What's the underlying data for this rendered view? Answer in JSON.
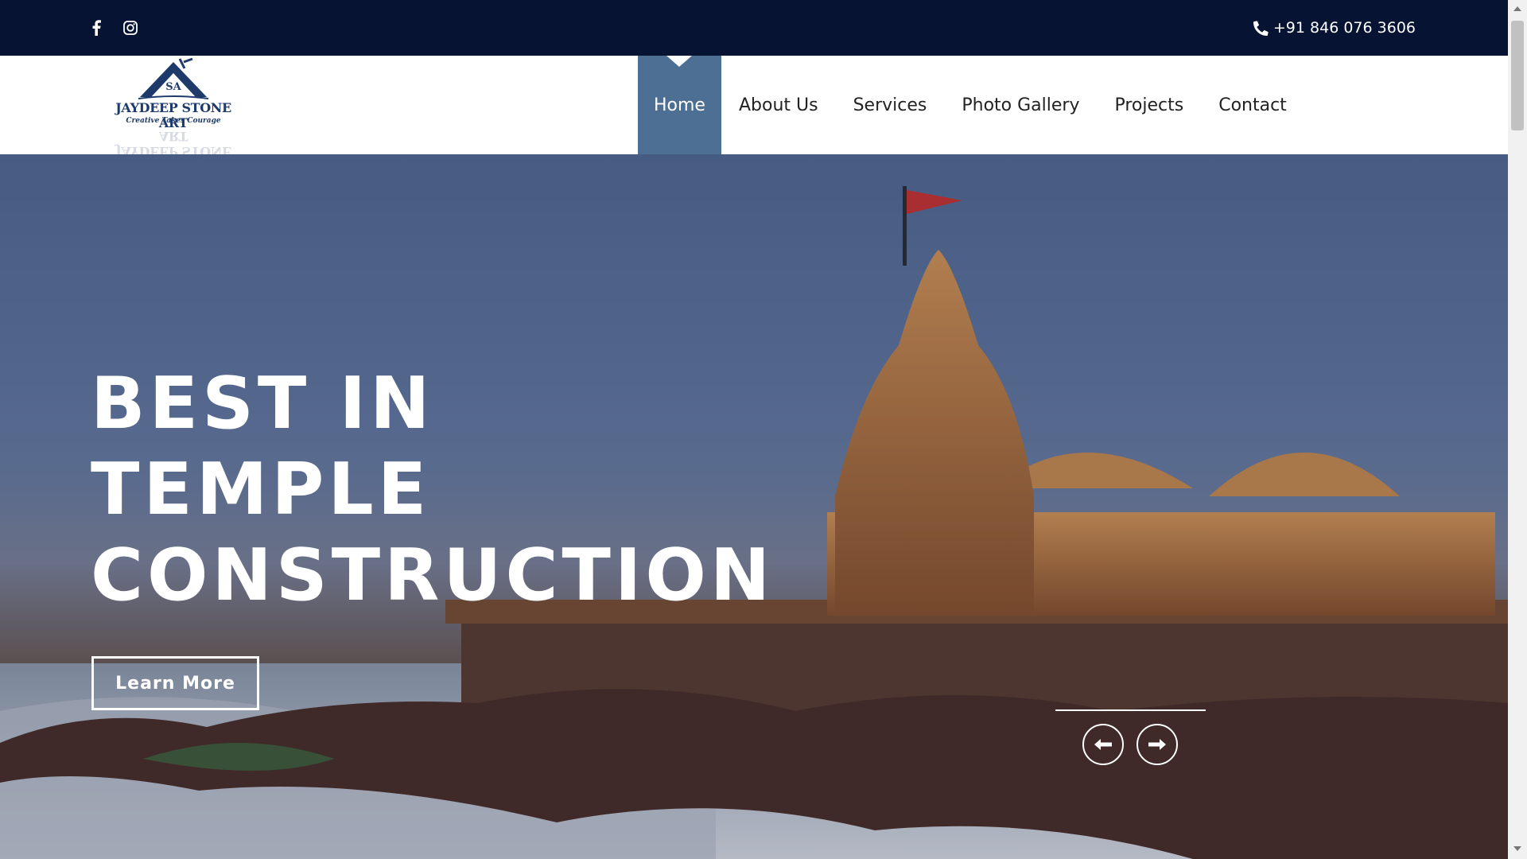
{
  "topbar": {
    "social": [
      {
        "name": "facebook",
        "icon": "facebook-icon"
      },
      {
        "name": "instagram",
        "icon": "instagram-icon"
      }
    ],
    "phone_icon": "phone-icon",
    "phone": "+91 846 076 3606"
  },
  "logo": {
    "wordmark": "JAYDEEP STONE ART",
    "tagline": "Creative Takes Courage",
    "monogram": "SA"
  },
  "nav": {
    "items": [
      {
        "label": "Home",
        "active": true
      },
      {
        "label": "About Us",
        "active": false
      },
      {
        "label": "Services",
        "active": false
      },
      {
        "label": "Photo Gallery",
        "active": false
      },
      {
        "label": "Projects",
        "active": false
      },
      {
        "label": "Contact",
        "active": false
      }
    ],
    "active_color": "#4e6f94"
  },
  "hero": {
    "title_lines": [
      "BEST IN",
      "TEMPLE",
      "CONSTRUCTION"
    ],
    "cta_label": "Learn More",
    "prev_icon": "arrow-left-icon",
    "next_icon": "arrow-right-icon"
  },
  "colors": {
    "topbar_bg": "#061333",
    "brand_blue": "#1d3a6b"
  }
}
